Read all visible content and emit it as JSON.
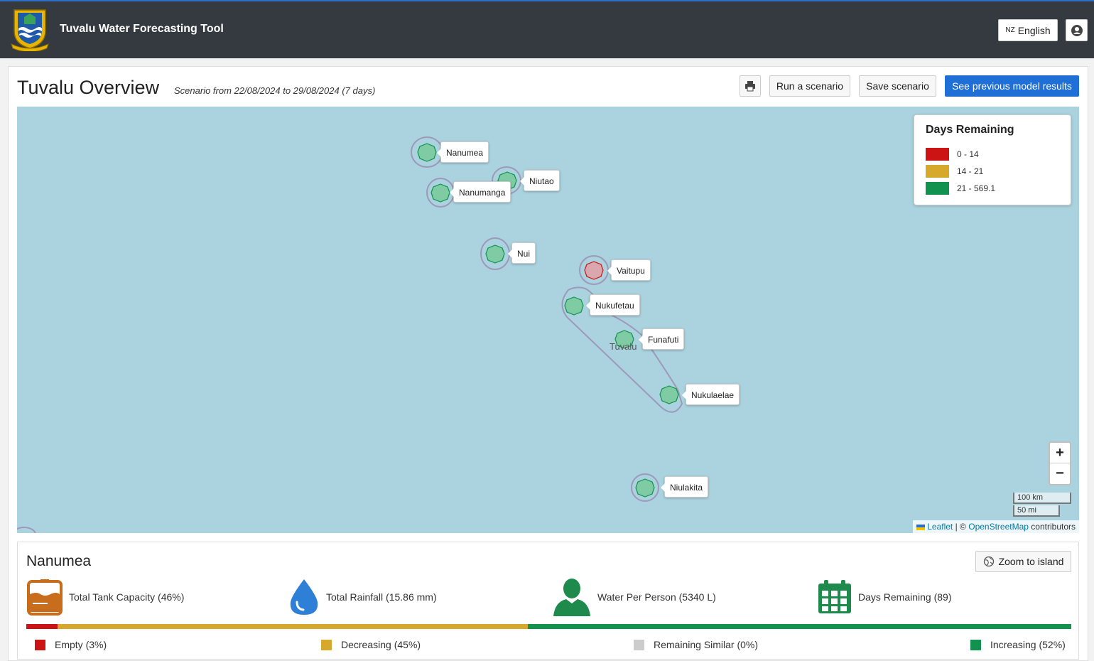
{
  "header": {
    "app_title": "Tuvalu Water Forecasting Tool",
    "language_flag": "NZ",
    "language_label": "English",
    "logo_icon": "tuvalu-coat-of-arms",
    "user_icon": "user-icon",
    "accent_color": "#2e6dc4",
    "bg_color": "#343a40"
  },
  "page": {
    "title": "Tuvalu Overview",
    "subtitle": "Scenario from 22/08/2024 to 29/08/2024 (7 days)"
  },
  "toolbar": {
    "print_icon": "printer-icon",
    "run_label": "Run a scenario",
    "save_label": "Save scenario",
    "previous_label": "See previous model results"
  },
  "map": {
    "country_label": "Tuvalu",
    "islands": [
      {
        "name": "Nanumea",
        "status": "green"
      },
      {
        "name": "Niutao",
        "status": "green"
      },
      {
        "name": "Nanumanga",
        "status": "green"
      },
      {
        "name": "Nui",
        "status": "green"
      },
      {
        "name": "Vaitupu",
        "status": "red"
      },
      {
        "name": "Nukufetau",
        "status": "green"
      },
      {
        "name": "Funafuti",
        "status": "green"
      },
      {
        "name": "Nukulaelae",
        "status": "green"
      },
      {
        "name": "Niulakita",
        "status": "green"
      }
    ],
    "legend": {
      "title": "Days Remaining",
      "items": [
        {
          "label": "0 - 14",
          "color": "#cc1414"
        },
        {
          "label": "14 - 21",
          "color": "#d6a82c"
        },
        {
          "label": "21 - 569.1",
          "color": "#12924f"
        }
      ]
    },
    "zoom_in": "+",
    "zoom_out": "−",
    "scale_km": "100 km",
    "scale_mi": "50 mi",
    "attribution": {
      "leaflet": "Leaflet",
      "separator": "| ©",
      "osm": "OpenStreetMap",
      "suffix": "contributors"
    }
  },
  "island_panel": {
    "name": "Nanumea",
    "zoom_label": "Zoom to island",
    "stats": {
      "tank": "Total Tank Capacity (46%)",
      "rainfall": "Total Rainfall (15.86 mm)",
      "per_person": "Water Per Person (5340 L)",
      "days": "Days Remaining (89)"
    },
    "breakdown": [
      {
        "label": "Empty (3%)",
        "percent": 3,
        "color": "#cc1414"
      },
      {
        "label": "Decreasing (45%)",
        "percent": 45,
        "color": "#d6a82c"
      },
      {
        "label": "Remaining Similar (0%)",
        "percent": 0,
        "color": "#cccccc"
      },
      {
        "label": "Increasing (52%)",
        "percent": 52,
        "color": "#12924f"
      }
    ]
  }
}
